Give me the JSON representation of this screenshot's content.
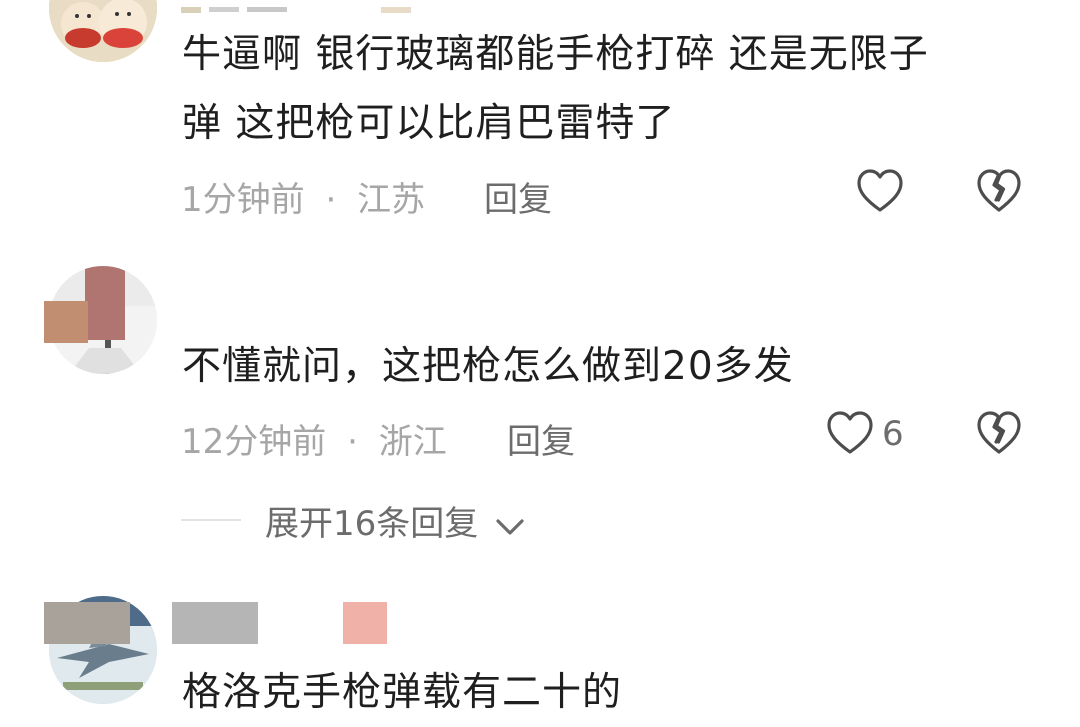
{
  "comments": [
    {
      "text_line1": "牛逼啊 银行玻璃都能手枪打碎 还是无限子",
      "text_line2": "弹 这把枪可以比肩巴雷特了",
      "time": "1分钟前",
      "separator": "·",
      "location": "江苏",
      "reply_label": "回复",
      "avatar_icon": "cartoon-avatar-icon"
    },
    {
      "text": "不懂就问，这把枪怎么做到20多发",
      "time": "12分钟前",
      "separator": "·",
      "location": "浙江",
      "reply_label": "回复",
      "likes": "6",
      "expand_label": "展开16条回复",
      "avatar_icon": "pixelated-avatar-icon"
    },
    {
      "text": "格洛克手枪弹载有二十的",
      "avatar_icon": "fighter-jet-avatar-icon"
    }
  ],
  "colors": {
    "meta_text": "#a6a6a6",
    "action_text": "#6c6c6c",
    "comment_text": "#1f1f1f",
    "icon_stroke": "#4d4d4d"
  }
}
